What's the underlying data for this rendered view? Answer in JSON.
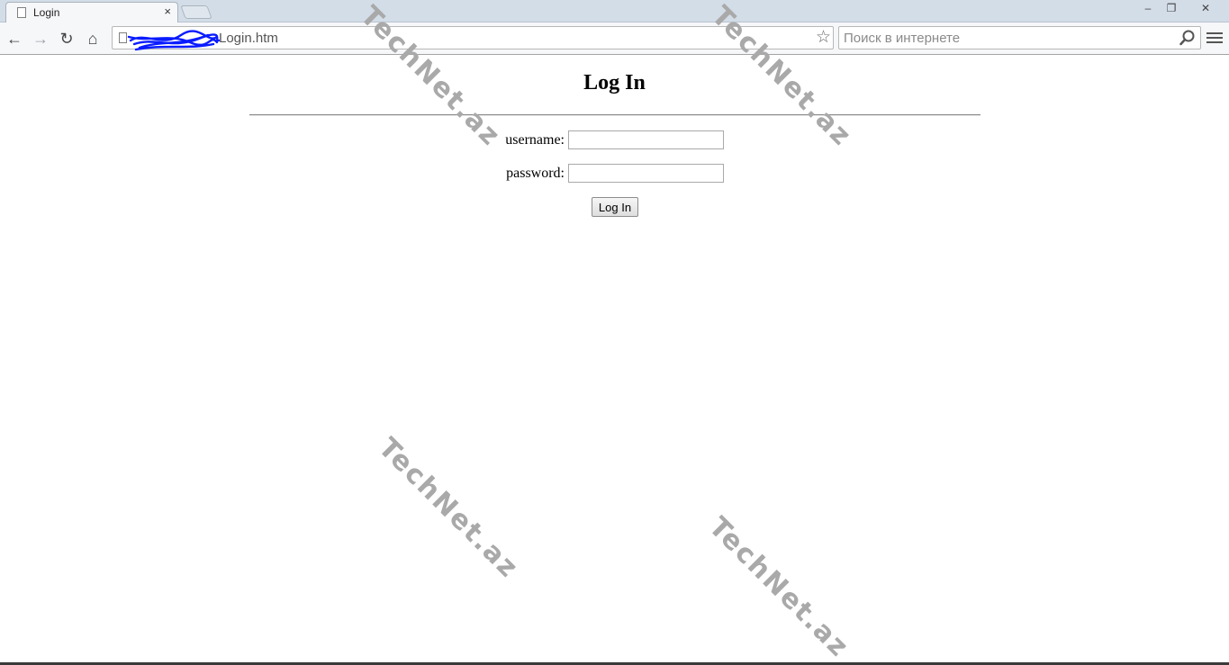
{
  "browser": {
    "tab_title": "Login",
    "tab_close": "×",
    "url": "Login.htm",
    "search_placeholder": "Поиск в интернете",
    "star": "☆",
    "window_controls": {
      "minimize": "‒",
      "maximize": "❐",
      "close": "✕"
    },
    "nav": {
      "back": "←",
      "forward": "→",
      "reload": "↻",
      "home": "⌂"
    }
  },
  "page": {
    "heading": "Log In",
    "username_label": "username:",
    "username_value": "",
    "password_label": "password:",
    "password_value": "",
    "submit_label": "Log In"
  },
  "watermark": {
    "text": "TechNet.az"
  }
}
